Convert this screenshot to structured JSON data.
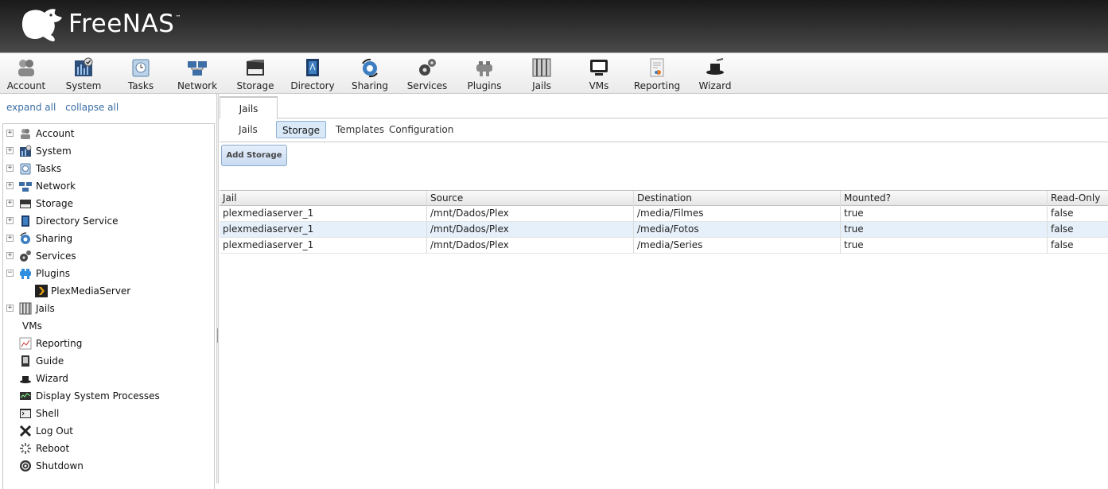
{
  "app": {
    "brand": "FreeNAS",
    "trademark": "™"
  },
  "toolbar": {
    "items": [
      {
        "label": "Account",
        "icon": "account-icon"
      },
      {
        "label": "System",
        "icon": "system-icon"
      },
      {
        "label": "Tasks",
        "icon": "tasks-icon"
      },
      {
        "label": "Network",
        "icon": "network-icon"
      },
      {
        "label": "Storage",
        "icon": "storage-icon"
      },
      {
        "label": "Directory",
        "icon": "directory-icon"
      },
      {
        "label": "Sharing",
        "icon": "sharing-icon"
      },
      {
        "label": "Services",
        "icon": "services-icon"
      },
      {
        "label": "Plugins",
        "icon": "plugins-icon"
      },
      {
        "label": "Jails",
        "icon": "jails-icon"
      },
      {
        "label": "VMs",
        "icon": "vms-icon"
      },
      {
        "label": "Reporting",
        "icon": "reporting-icon"
      },
      {
        "label": "Wizard",
        "icon": "wizard-icon"
      }
    ]
  },
  "sidebar": {
    "expand_all": "expand all",
    "collapse_all": "collapse all",
    "items": [
      {
        "label": "Account",
        "expander": "+"
      },
      {
        "label": "System",
        "expander": "+"
      },
      {
        "label": "Tasks",
        "expander": "+"
      },
      {
        "label": "Network",
        "expander": "+"
      },
      {
        "label": "Storage",
        "expander": "+"
      },
      {
        "label": "Directory Service",
        "expander": "+"
      },
      {
        "label": "Sharing",
        "expander": "+"
      },
      {
        "label": "Services",
        "expander": "+"
      },
      {
        "label": "Plugins",
        "expander": "−"
      },
      {
        "label": "PlexMediaServer",
        "expander": ""
      },
      {
        "label": "Jails",
        "expander": "+"
      },
      {
        "label": "VMs",
        "expander": ""
      },
      {
        "label": "Reporting",
        "expander": ""
      },
      {
        "label": "Guide",
        "expander": ""
      },
      {
        "label": "Wizard",
        "expander": ""
      },
      {
        "label": "Display System Processes",
        "expander": ""
      },
      {
        "label": "Shell",
        "expander": ""
      },
      {
        "label": "Log Out",
        "expander": ""
      },
      {
        "label": "Reboot",
        "expander": ""
      },
      {
        "label": "Shutdown",
        "expander": ""
      }
    ]
  },
  "main": {
    "outer_tab": "Jails",
    "inner_tabs": [
      "Jails",
      "Storage",
      "Templates",
      "Configuration"
    ],
    "active_inner_tab": "Storage",
    "add_button": "Add Storage",
    "table": {
      "columns": [
        "Jail",
        "Source",
        "Destination",
        "Mounted?",
        "Read-Only"
      ],
      "rows": [
        [
          "plexmediaserver_1",
          "/mnt/Dados/Plex",
          "/media/Filmes",
          "true",
          "false"
        ],
        [
          "plexmediaserver_1",
          "/mnt/Dados/Plex",
          "/media/Fotos",
          "true",
          "false"
        ],
        [
          "plexmediaserver_1",
          "/mnt/Dados/Plex",
          "/media/Series",
          "true",
          "false"
        ]
      ],
      "selected_row": 1
    }
  },
  "colors": {
    "header_bg": "#2b2b2b",
    "link": "#3a6ea5",
    "active_tab_bg": "#d9e9f8",
    "selected_row_bg": "#e6f0fa"
  }
}
